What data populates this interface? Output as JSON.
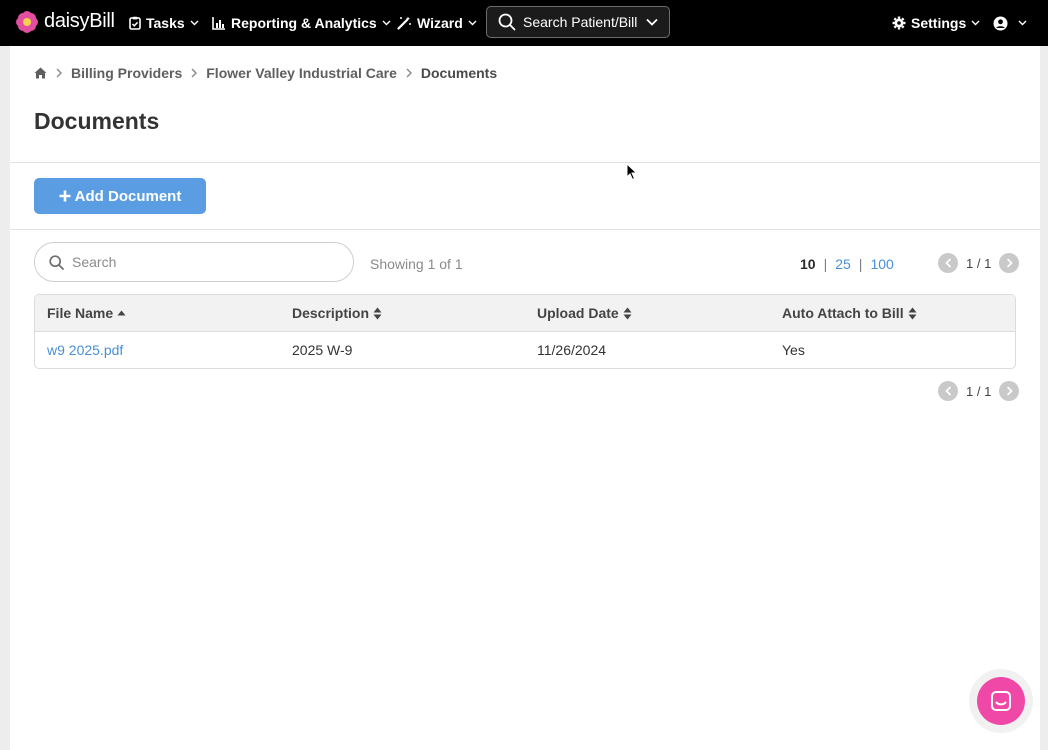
{
  "app": {
    "logo_text": "daisyBill"
  },
  "nav": {
    "tasks": "Tasks",
    "reporting": "Reporting & Analytics",
    "wizard": "Wizard",
    "search_label": "Search Patient/Bill",
    "settings": "Settings"
  },
  "breadcrumb": {
    "items": [
      "Billing Providers",
      "Flower Valley Industrial Care",
      "Documents"
    ]
  },
  "page": {
    "title": "Documents"
  },
  "toolbar": {
    "add_label": "Add Document"
  },
  "list": {
    "search_placeholder": "Search",
    "showing": "Showing 1 of 1",
    "per_page": [
      "10",
      "25",
      "100"
    ],
    "per_page_active": "10",
    "page_indicator": "1 / 1"
  },
  "table": {
    "columns": [
      "File Name",
      "Description",
      "Upload Date",
      "Auto Attach to Bill"
    ],
    "rows": [
      {
        "file_name": "w9 2025.pdf",
        "description": "2025 W-9",
        "upload_date": "11/26/2024",
        "auto_attach": "Yes"
      }
    ]
  },
  "colors": {
    "accent_blue": "#5a9de3",
    "link_blue": "#4a8fd6",
    "chat_pink": "#ef48a6",
    "nav_bg": "#000000"
  }
}
